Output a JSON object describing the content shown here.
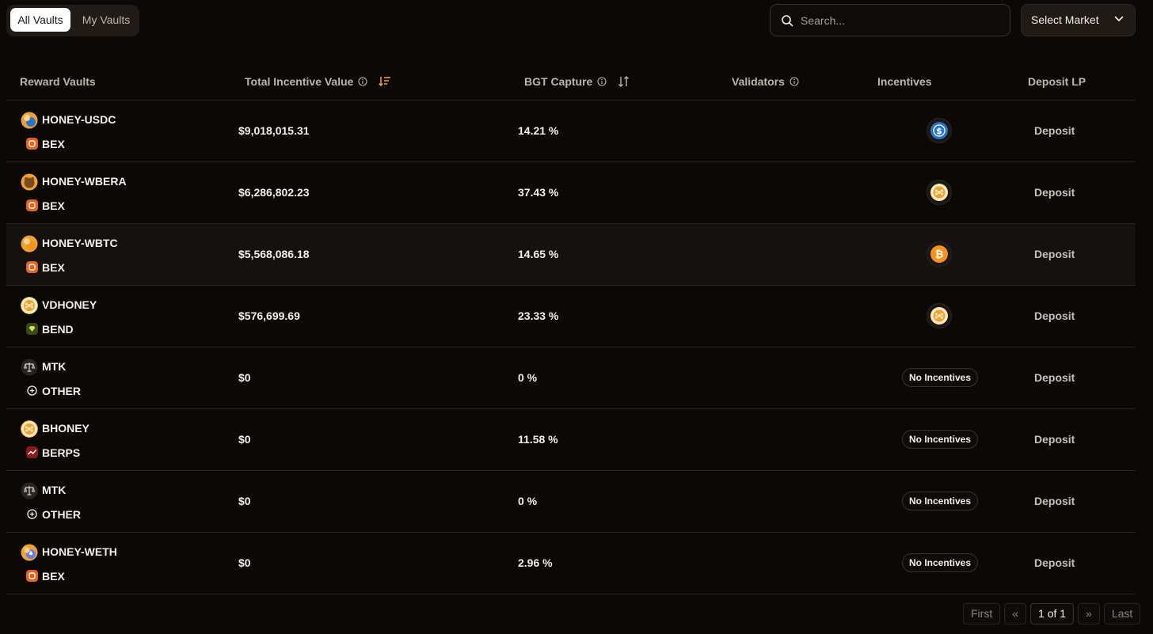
{
  "tabs": {
    "all": "All Vaults",
    "mine": "My Vaults"
  },
  "search": {
    "placeholder": "Search..."
  },
  "market": {
    "label": "Select Market"
  },
  "table": {
    "headers": {
      "reward_vaults": "Reward Vaults",
      "total_incentive_value": "Total Incentive Value",
      "bgt_capture": "BGT Capture",
      "validators": "Validators",
      "incentives": "Incentives",
      "deposit_lp": "Deposit LP"
    },
    "rows": [
      {
        "vault": "HONEY-USDC",
        "protocol": "BEX",
        "tiv": "$9,018,015.31",
        "bgt": "14.21 %",
        "incentive": "usdc-icon",
        "deposit": "Deposit"
      },
      {
        "vault": "HONEY-WBERA",
        "protocol": "BEX",
        "tiv": "$6,286,802.23",
        "bgt": "37.43 %",
        "incentive": "honey-icon",
        "deposit": "Deposit"
      },
      {
        "vault": "HONEY-WBTC",
        "protocol": "BEX",
        "tiv": "$5,568,086.18",
        "bgt": "14.65 %",
        "incentive": "bitcoin-icon",
        "deposit": "Deposit"
      },
      {
        "vault": "VDHONEY",
        "protocol": "BEND",
        "tiv": "$576,699.69",
        "bgt": "23.33 %",
        "incentive": "honey-icon",
        "deposit": "Deposit"
      },
      {
        "vault": "MTK",
        "protocol": "OTHER",
        "tiv": "$0",
        "bgt": "0 %",
        "incentive_text": "No Incentives",
        "deposit": "Deposit"
      },
      {
        "vault": "BHONEY",
        "protocol": "BERPS",
        "tiv": "$0",
        "bgt": "11.58 %",
        "incentive_text": "No Incentives",
        "deposit": "Deposit"
      },
      {
        "vault": "MTK",
        "protocol": "OTHER",
        "tiv": "$0",
        "bgt": "0 %",
        "incentive_text": "No Incentives",
        "deposit": "Deposit"
      },
      {
        "vault": "HONEY-WETH",
        "protocol": "BEX",
        "tiv": "$0",
        "bgt": "2.96 %",
        "incentive_text": "No Incentives",
        "deposit": "Deposit"
      }
    ]
  },
  "pagination": {
    "first": "First",
    "prev": "«",
    "current": "1 of 1",
    "next": "»",
    "last": "Last"
  },
  "colors": {
    "background": "#0c0806",
    "sort_active": "#f5a623",
    "bex": "#e8621c",
    "usdc": "#2775ca",
    "bitcoin": "#f7931a",
    "honey": "#f0a130"
  }
}
